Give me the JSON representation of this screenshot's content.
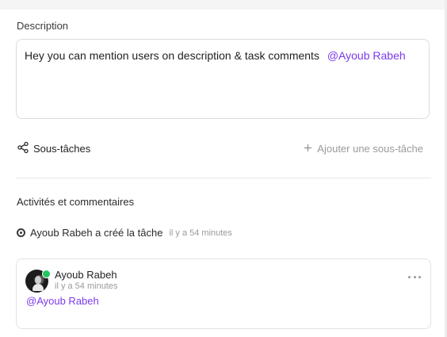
{
  "description": {
    "label": "Description",
    "text": "Hey you can mention users on description & task comments",
    "mention": "@Ayoub Rabeh"
  },
  "subtasks": {
    "label": "Sous-tâches",
    "add_label": "Ajouter une sous-tâche",
    "icon": "share-nodes-icon",
    "add_icon": "plus-icon"
  },
  "activities": {
    "title": "Activités et commentaires",
    "events": [
      {
        "text": "Ayoub Rabeh a créé la tâche",
        "time": "il y a 54 minutes"
      }
    ],
    "comments": [
      {
        "author": "Ayoub Rabeh",
        "time": "il y a 54 minutes",
        "body": "@Ayoub Rabeh",
        "online": true
      }
    ]
  },
  "colors": {
    "mention": "#7c3aed",
    "online": "#22c55e",
    "muted": "#9a9a9a"
  }
}
